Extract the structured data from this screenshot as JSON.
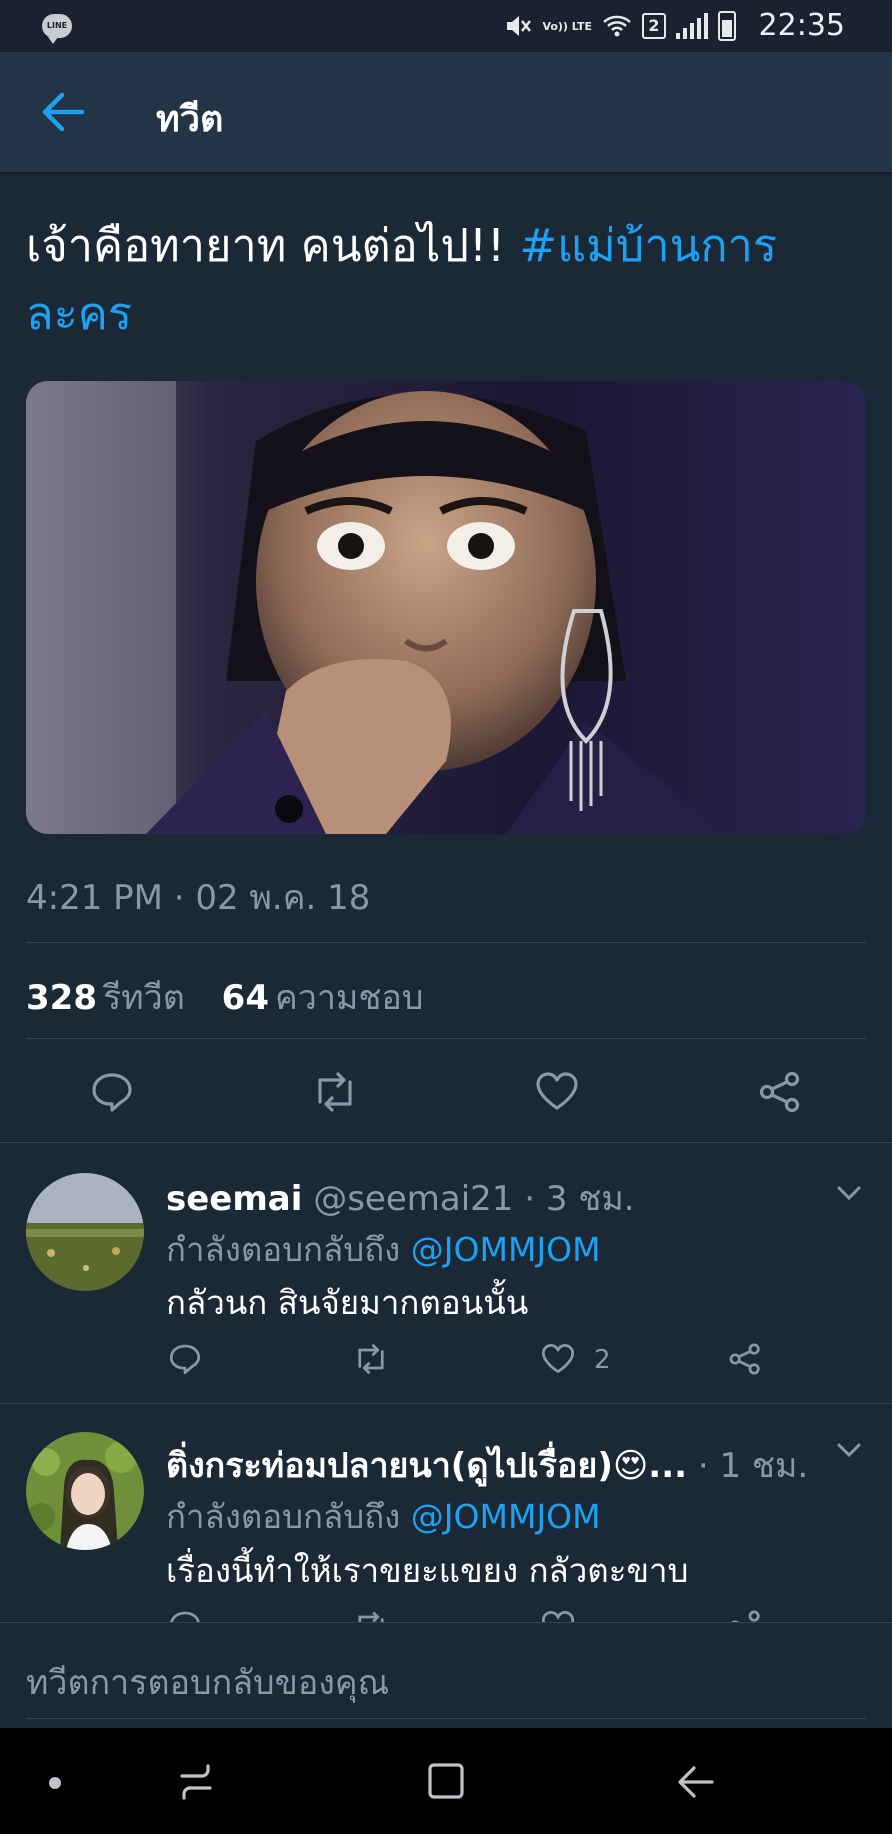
{
  "status_bar": {
    "app_icon": "line-icon",
    "lte_text": "Vo)) LTE",
    "sim_badge": "2",
    "time": "22:35"
  },
  "app_bar": {
    "title": "ทวีต"
  },
  "tweet": {
    "text": "เจ้าคือทายาท คนต่อไป!!",
    "hashtag": "#แม่บ้านการละคร",
    "timestamp": "4:21 PM · 02 พ.ค. 18",
    "retweets": {
      "count": "328",
      "label": "รีทวีต"
    },
    "likes": {
      "count": "64",
      "label": "ความชอบ"
    }
  },
  "replies": [
    {
      "name": "seemai",
      "handle": "@seemai21",
      "time": "· 3 ชม.",
      "replying_to_label": "กำลังตอบกลับถึง",
      "mention": "@JOMMJOM",
      "text": "กลัวนก สินจัยมากตอนนั้น",
      "like_count": "2"
    },
    {
      "name": "ติ่งกระท่อมปลายนา(ดูไปเรื่อย)😍...",
      "handle": "",
      "time": "· 1 ชม.",
      "replying_to_label": "กำลังตอบกลับถึง",
      "mention": "@JOMMJOM",
      "text": "เรื่องนี้ทำให้เราขยะแขยง กลัวตะขาบ",
      "like_count": ""
    }
  ],
  "composer": {
    "placeholder": "ทวีตการตอบกลับของคุณ"
  },
  "colors": {
    "background": "#1b2836",
    "app_bar": "#243447",
    "accent": "#1da1f2",
    "secondary_text": "#8899a6",
    "divider": "#38444d"
  }
}
